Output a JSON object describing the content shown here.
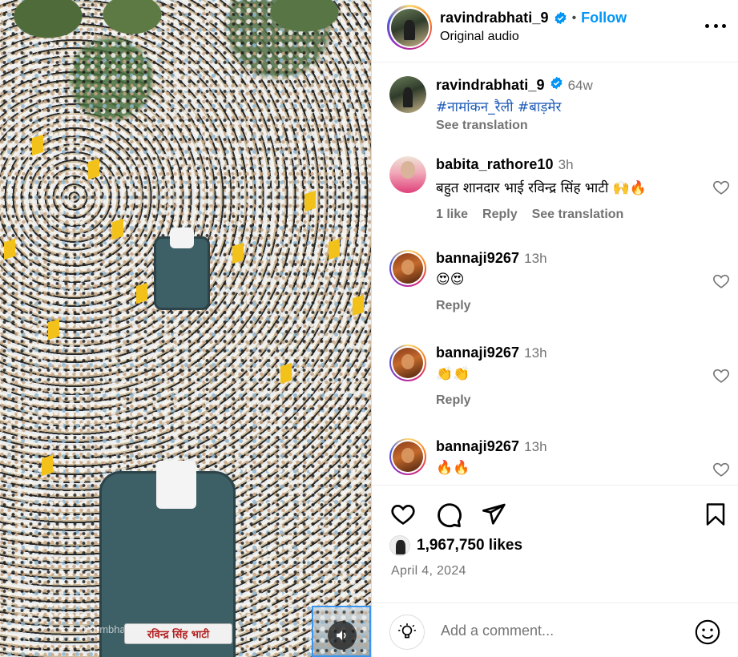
{
  "post": {
    "author": "ravindrabhati_9",
    "follow_label": "Follow",
    "dot": "•",
    "audio": "Original audio",
    "plate_text": "रविन्द्र सिंह भाटी",
    "watermark": "Parmbhan Pr ... Barm"
  },
  "caption": {
    "username": "ravindrabhati_9",
    "time": "64w",
    "hashtags": "#नामांकन_रैली #बाड़मेर",
    "see_translation": "See translation"
  },
  "comments": [
    {
      "username": "babita_rathore10",
      "time": "3h",
      "text": "बहुत शानदार भाई रविन्द्र सिंह भाटी 🙌🔥",
      "likes": "1 like",
      "reply": "Reply",
      "see_translation": "See translation"
    },
    {
      "username": "bannaji9267",
      "time": "13h",
      "text": "😍😍",
      "reply": "Reply"
    },
    {
      "username": "bannaji9267",
      "time": "13h",
      "text": "👏👏",
      "reply": "Reply"
    },
    {
      "username": "bannaji9267",
      "time": "13h",
      "text": "🔥🔥"
    }
  ],
  "stats": {
    "likes": "1,967,750 likes",
    "date": "April 4, 2024"
  },
  "composer": {
    "placeholder": "Add a comment..."
  },
  "colors": {
    "accent": "#0095f6",
    "hashtag": "#1c5ab8",
    "muted": "#737373",
    "flag": "#f2c21b"
  },
  "icons": [
    "verified-badge-icon",
    "more-options-icon",
    "heart-icon",
    "comment-icon",
    "share-icon",
    "bookmark-icon",
    "sound-icon",
    "emoji-icon",
    "smiley-icon"
  ]
}
